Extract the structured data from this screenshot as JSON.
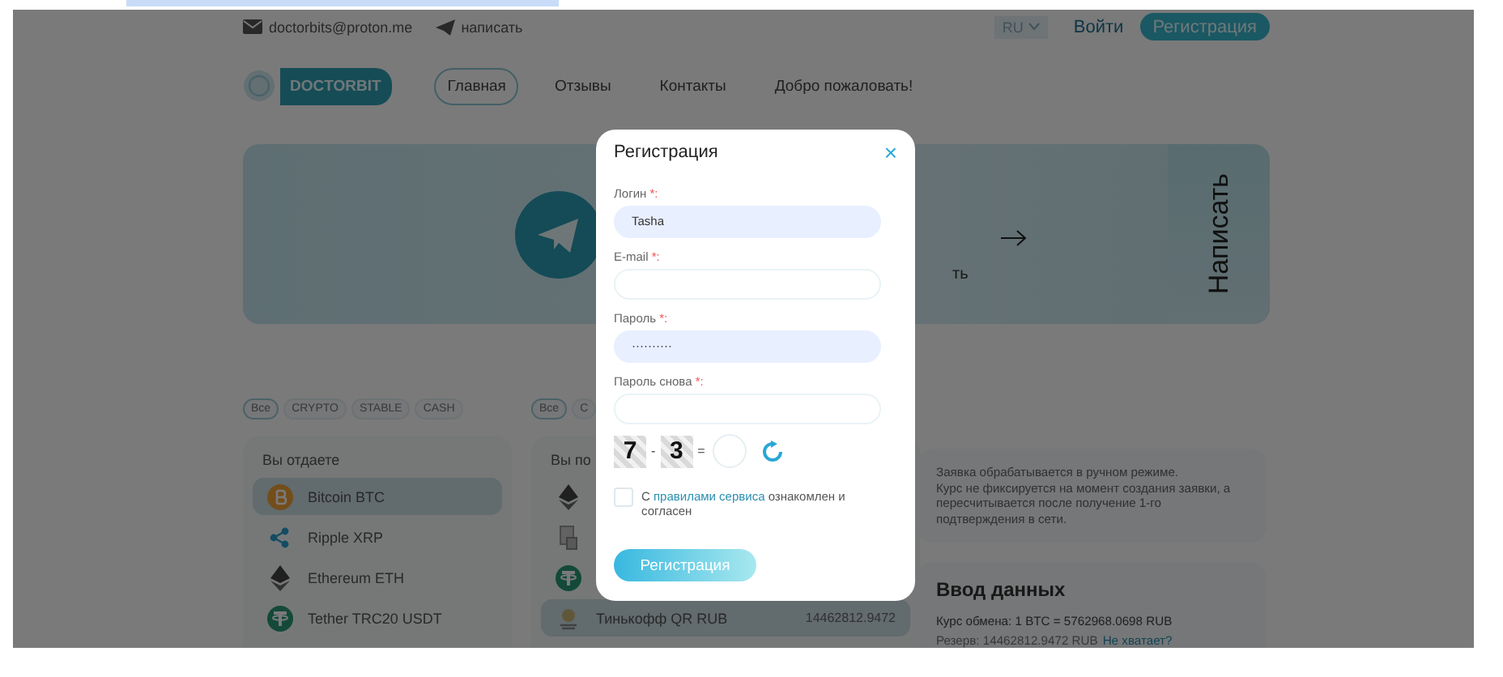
{
  "header": {
    "email": "doctorbits@proton.me",
    "write_link": "написать",
    "language": "RU",
    "login": "Войти",
    "register": "Регистрация"
  },
  "nav": {
    "logo": "DOCTORBIT",
    "items": [
      {
        "label": "Главная",
        "selected": true
      },
      {
        "label": "Отзывы",
        "selected": false
      },
      {
        "label": "Контакты",
        "selected": false
      },
      {
        "label": "Добро пожаловать!",
        "selected": false
      }
    ]
  },
  "banner": {
    "text_fragment": "ть",
    "side_button": "Написать"
  },
  "give": {
    "filters": [
      {
        "label": "Все",
        "selected": true
      },
      {
        "label": "CRYPTO",
        "selected": false
      },
      {
        "label": "STABLE",
        "selected": false
      },
      {
        "label": "CASH",
        "selected": false
      }
    ],
    "title": "Вы отдаете",
    "items": [
      {
        "kind": "bitcoin",
        "label": "Bitcoin BTC",
        "selected": true
      },
      {
        "kind": "ripple",
        "label": "Ripple XRP",
        "selected": false
      },
      {
        "kind": "ethereum",
        "label": "Ethereum ETH",
        "selected": false
      },
      {
        "kind": "tether",
        "label": "Tether TRC20 USDT",
        "selected": false
      }
    ]
  },
  "receive": {
    "filters": [
      {
        "label": "Все",
        "selected": true
      },
      {
        "label": "C",
        "selected": false
      }
    ],
    "title": "Вы по",
    "items": [
      {
        "kind": "ethereum",
        "selected": false
      },
      {
        "kind": "document",
        "selected": false
      },
      {
        "kind": "tether",
        "selected": false
      },
      {
        "kind": "bank",
        "label": "Тинькофф QR RUB",
        "reserve": "14462812.9472",
        "selected": true
      }
    ]
  },
  "notice": {
    "lines": [
      "Заявка обрабатывается в ручном режиме.",
      "Курс не фиксируется на момент создания заявки, а пересчитывается после получение 1-го подтверждения в сети."
    ]
  },
  "data_entry": {
    "title": "Ввод данных",
    "rate": "Курс обмена: 1 BTC = 5762968.0698 RUB",
    "reserve": "Резерв: 14462812.9472 RUB",
    "reserve_link": "Не хватает?"
  },
  "modal": {
    "title": "Регистрация",
    "close": "×",
    "fields": [
      {
        "label": "Логин",
        "mark": "*:",
        "value": "Tasha",
        "autofilled": true
      },
      {
        "label": "E-mail",
        "mark": "*:",
        "autofilled": false
      },
      {
        "label": "Пароль",
        "mark": "*:",
        "value": "··········",
        "autofilled": true
      },
      {
        "label": "Пароль снова",
        "mark": "*:",
        "autofilled": false
      }
    ],
    "captcha": {
      "first": "7",
      "operator": "-",
      "second": "3",
      "equals": "="
    },
    "agreement": {
      "checked": false,
      "before": "С",
      "link": "правилами сервиса",
      "after": "ознакомлен и согласен"
    },
    "submit": "Регистрация"
  }
}
